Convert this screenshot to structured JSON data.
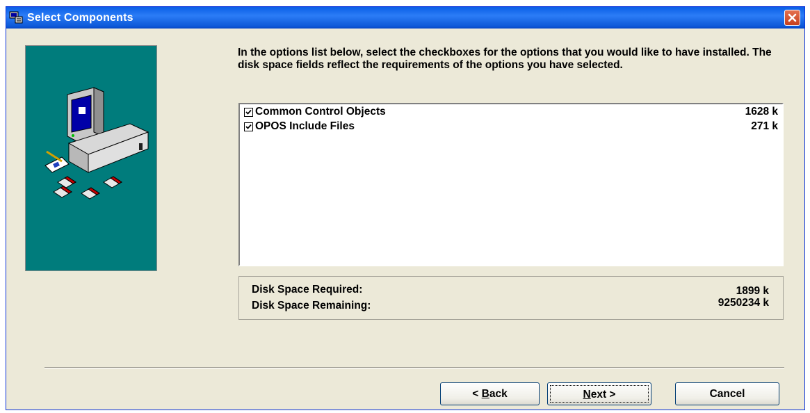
{
  "window": {
    "title": "Select Components",
    "title_icon": "setup-computer-icon",
    "close_icon": "close-icon"
  },
  "instructions": "In the options list below, select the checkboxes for the options that you would like to have installed.  The disk space fields reflect the requirements of the options you have selected.",
  "components": [
    {
      "label": "Common Control Objects",
      "size": "1628 k",
      "checked": true
    },
    {
      "label": "OPOS Include Files",
      "size": "271 k",
      "checked": true
    }
  ],
  "disk": {
    "required_label": "Disk Space Required:",
    "required_value": "1899 k",
    "remaining_label": "Disk Space Remaining:",
    "remaining_value": "9250234 k"
  },
  "buttons": {
    "back_prefix": "< ",
    "back_accel": "B",
    "back_rest": "ack",
    "next_accel": "N",
    "next_rest": "ext >",
    "cancel": "Cancel"
  },
  "colors": {
    "titlebar": "#0a5fe6",
    "dialog_bg": "#ece9d8",
    "side_panel": "#007c7c"
  }
}
